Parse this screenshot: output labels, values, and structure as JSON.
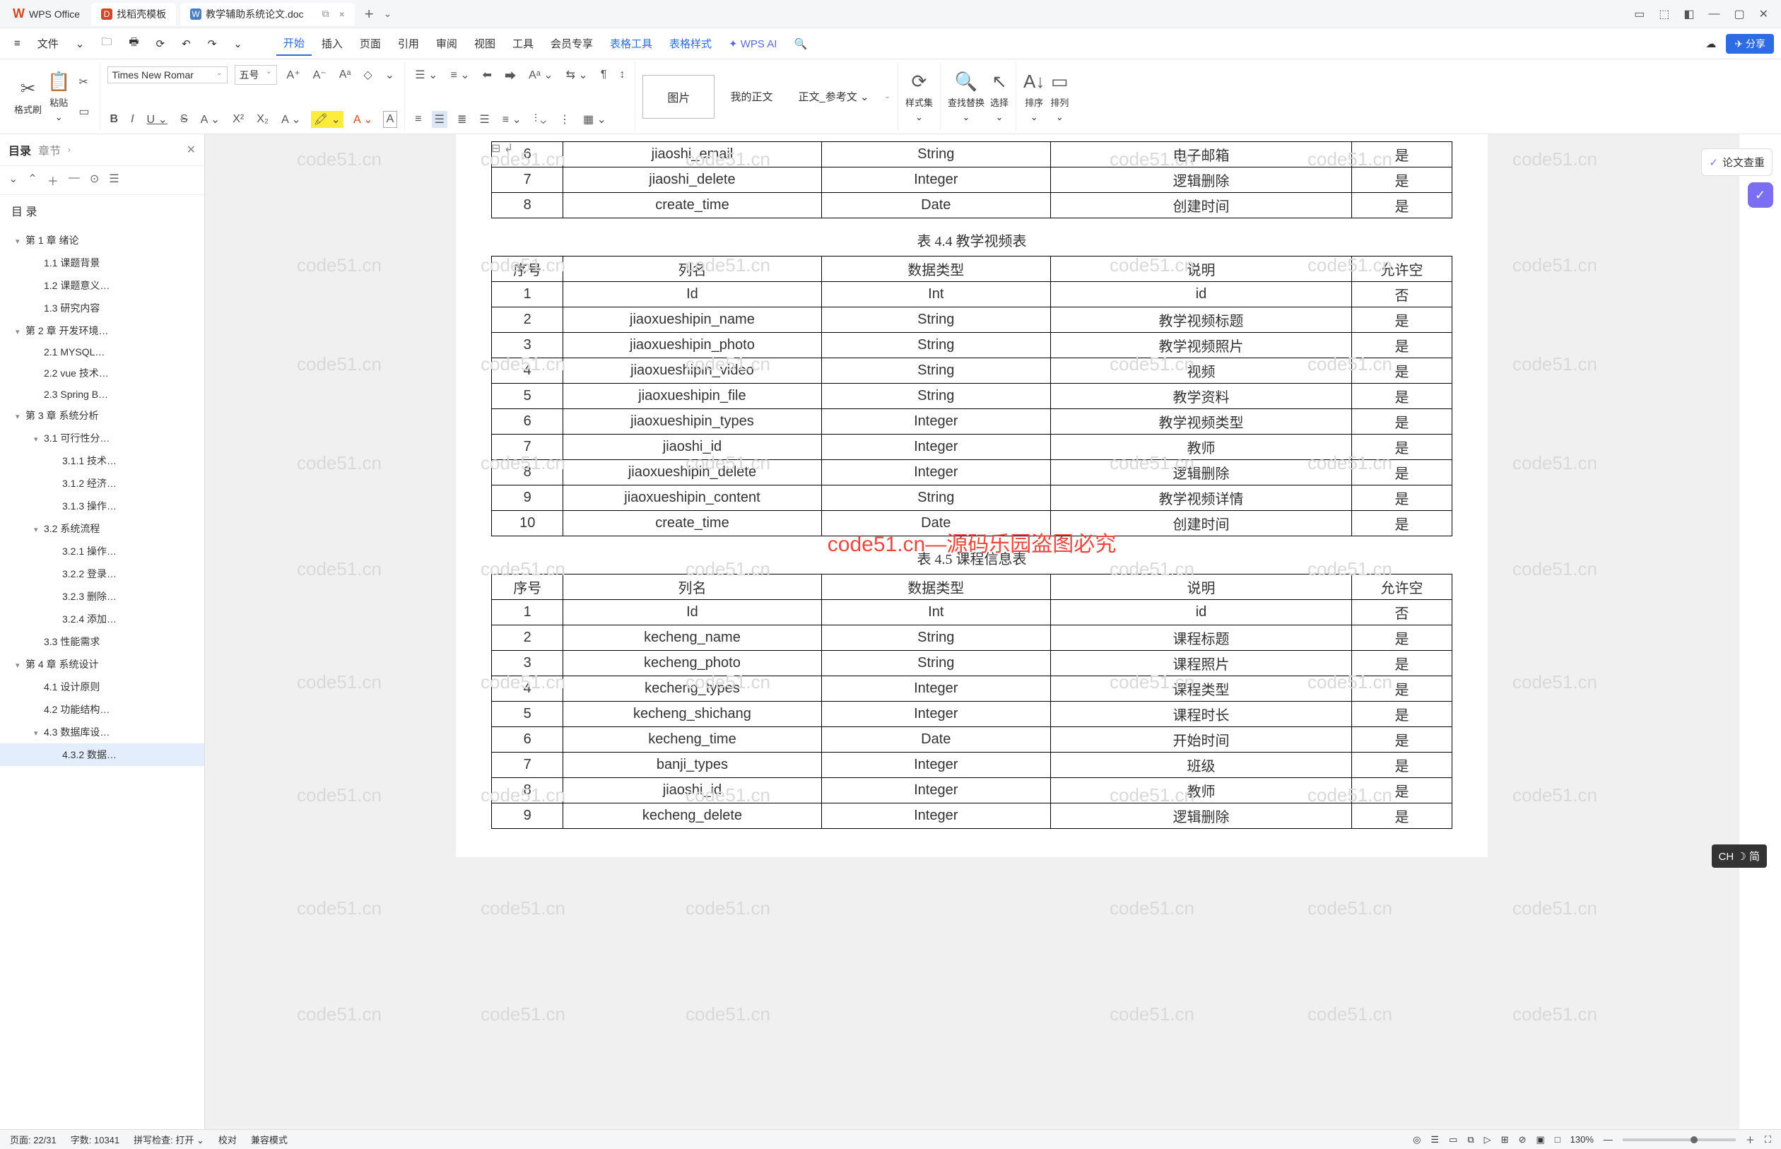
{
  "title_bar": {
    "app_name": "WPS Office",
    "tabs": [
      {
        "icon": "D",
        "label": "找稻壳模板"
      },
      {
        "icon": "W",
        "label": "教学辅助系统论文.doc"
      }
    ],
    "tab_restore": "⧉",
    "tab_close": "×",
    "add": "+",
    "dd": "⌄",
    "win": {
      "panel": "▭",
      "cube": "⬚",
      "user": "◧",
      "min": "—",
      "max": "▢",
      "close": "✕"
    }
  },
  "menu": {
    "left_icons": [
      "≡",
      "文件",
      "⌄",
      "🗀",
      "🖶",
      "⟳",
      "↶",
      "↷",
      "⌄"
    ],
    "items": [
      "开始",
      "插入",
      "页面",
      "引用",
      "审阅",
      "视图",
      "工具",
      "会员专享",
      "表格工具",
      "表格样式"
    ],
    "ai": "WPS AI",
    "search": "🔍",
    "right": {
      "cloud": "☁",
      "share": "分享"
    }
  },
  "ribbon": {
    "brush": "✂",
    "brush_lbl": "格式刷",
    "paste": "📋",
    "paste_lbl": "粘贴",
    "cut": "✂",
    "copy": "▭",
    "font": "Times New Romar",
    "size": "五号",
    "btns_top": [
      "A⁺",
      "A⁻",
      "Aᵃ",
      "◇",
      "⌄"
    ],
    "btns_bot": [
      "B",
      "I",
      "U ⌄",
      "S",
      "A ⌄",
      "X²",
      "X₂",
      "A ⌄",
      "🖍 ⌄",
      "A ⌄",
      "A"
    ],
    "para_top": [
      "☰ ⌄",
      "≡ ⌄",
      "⬅",
      "⮕",
      "Aᵃ ⌄",
      "⇆ ⌄",
      "¶",
      "↕"
    ],
    "para_bot": [
      "≡",
      "☰",
      "≣",
      "☰",
      "≡ ⌄",
      "⫶ ⌄",
      "⋮",
      "▦ ⌄"
    ],
    "pic": "图片",
    "styles": [
      "我的正文",
      "正文_参考文"
    ],
    "style_set": "样式集",
    "find": "查找替换",
    "select": "选择",
    "sort": "排序",
    "arrange": "排列",
    "find_ic": "🔍",
    "sel_ic": "↖",
    "sort_ic": "A↓",
    "arr_ic": "▭",
    "set_ic": "⟳"
  },
  "outline": {
    "tab_catalog": "目录",
    "tab_chapter": "章节",
    "chev": "›",
    "close": "✕",
    "tools": [
      "⌄",
      "⌃",
      "＋",
      "—",
      "⊙",
      "☰"
    ],
    "title": "目 录",
    "items": [
      {
        "l": 0,
        "t": "第 1 章 绪论",
        "tw": "▾"
      },
      {
        "l": 1,
        "t": "1.1 课题背景"
      },
      {
        "l": 1,
        "t": "1.2 课题意义…"
      },
      {
        "l": 1,
        "t": "1.3 研究内容"
      },
      {
        "l": 0,
        "t": "第 2 章 开发环境…",
        "tw": "▾"
      },
      {
        "l": 1,
        "t": "2.1 MYSQL…"
      },
      {
        "l": 1,
        "t": "2.2 vue 技术…"
      },
      {
        "l": 1,
        "t": "2.3 Spring B…"
      },
      {
        "l": 0,
        "t": "第 3 章 系统分析",
        "tw": "▾"
      },
      {
        "l": 1,
        "t": "3.1 可行性分…",
        "tw": "▾"
      },
      {
        "l": 2,
        "t": "3.1.1 技术…"
      },
      {
        "l": 2,
        "t": "3.1.2 经济…"
      },
      {
        "l": 2,
        "t": "3.1.3 操作…"
      },
      {
        "l": 1,
        "t": "3.2 系统流程",
        "tw": "▾"
      },
      {
        "l": 2,
        "t": "3.2.1 操作…"
      },
      {
        "l": 2,
        "t": "3.2.2 登录…"
      },
      {
        "l": 2,
        "t": "3.2.3 删除…"
      },
      {
        "l": 2,
        "t": "3.2.4 添加…"
      },
      {
        "l": 1,
        "t": "3.3 性能需求"
      },
      {
        "l": 0,
        "t": "第 4 章 系统设计",
        "tw": "▾"
      },
      {
        "l": 1,
        "t": "4.1 设计原则"
      },
      {
        "l": 1,
        "t": "4.2 功能结构…"
      },
      {
        "l": 1,
        "t": "4.3 数据库设…",
        "tw": "▾"
      },
      {
        "l": 2,
        "t": "4.3.2 数据…",
        "sel": true
      }
    ]
  },
  "doc": {
    "fmt_mark": "⊟  ↲",
    "table43_tail": [
      [
        "6",
        "jiaoshi_email",
        "String",
        "电子邮箱",
        "是"
      ],
      [
        "7",
        "jiaoshi_delete",
        "Integer",
        "逻辑删除",
        "是"
      ],
      [
        "8",
        "create_time",
        "Date",
        "创建时间",
        "是"
      ]
    ],
    "caption44": "表 4.4 教学视频表",
    "header": [
      "序号",
      "列名",
      "数据类型",
      "说明",
      "允许空"
    ],
    "table44": [
      [
        "1",
        "Id",
        "Int",
        "id",
        "否"
      ],
      [
        "2",
        "jiaoxueshipin_name",
        "String",
        "教学视频标题",
        "是"
      ],
      [
        "3",
        "jiaoxueshipin_photo",
        "String",
        "教学视频照片",
        "是"
      ],
      [
        "4",
        "jiaoxueshipin_video",
        "String",
        "视频",
        "是"
      ],
      [
        "5",
        "jiaoxueshipin_file",
        "String",
        "教学资料",
        "是"
      ],
      [
        "6",
        "jiaoxueshipin_types",
        "Integer",
        "教学视频类型",
        "是"
      ],
      [
        "7",
        "jiaoshi_id",
        "Integer",
        "教师",
        "是"
      ],
      [
        "8",
        "jiaoxueshipin_delete",
        "Integer",
        "逻辑删除",
        "是"
      ],
      [
        "9",
        "jiaoxueshipin_content",
        "String",
        "教学视频详情",
        "是"
      ],
      [
        "10",
        "create_time",
        "Date",
        "创建时间",
        "是"
      ]
    ],
    "caption45": "表 4.5 课程信息表",
    "table45": [
      [
        "1",
        "Id",
        "Int",
        "id",
        "否"
      ],
      [
        "2",
        "kecheng_name",
        "String",
        "课程标题",
        "是"
      ],
      [
        "3",
        "kecheng_photo",
        "String",
        "课程照片",
        "是"
      ],
      [
        "4",
        "kecheng_types",
        "Integer",
        "课程类型",
        "是"
      ],
      [
        "5",
        "kecheng_shichang",
        "Integer",
        "课程时长",
        "是"
      ],
      [
        "6",
        "kecheng_time",
        "Date",
        "开始时间",
        "是"
      ],
      [
        "7",
        "banji_types",
        "Integer",
        "班级",
        "是"
      ],
      [
        "8",
        "jiaoshi_id",
        "Integer",
        "教师",
        "是"
      ],
      [
        "9",
        "kecheng_delete",
        "Integer",
        "逻辑删除",
        "是"
      ]
    ],
    "watermark": "code51.cn",
    "watermark_red": "code51.cn—源码乐园盗图必究"
  },
  "rail": {
    "fold": "《",
    "check": "论文查重",
    "check_ic": "✓"
  },
  "ime": "CH ☽ 简",
  "status": {
    "page": "页面: 22/31",
    "words": "字数: 10341",
    "spell": "拼写检查: 打开 ⌄",
    "proof": "校对",
    "compat": "兼容模式",
    "icons": [
      "◎",
      "☰",
      "▭",
      "⧉",
      "▷",
      "⊞",
      "⊘",
      "▣",
      "□"
    ],
    "zoom": "130%",
    "minus": "—",
    "plus": "＋",
    "full": "⛶"
  }
}
